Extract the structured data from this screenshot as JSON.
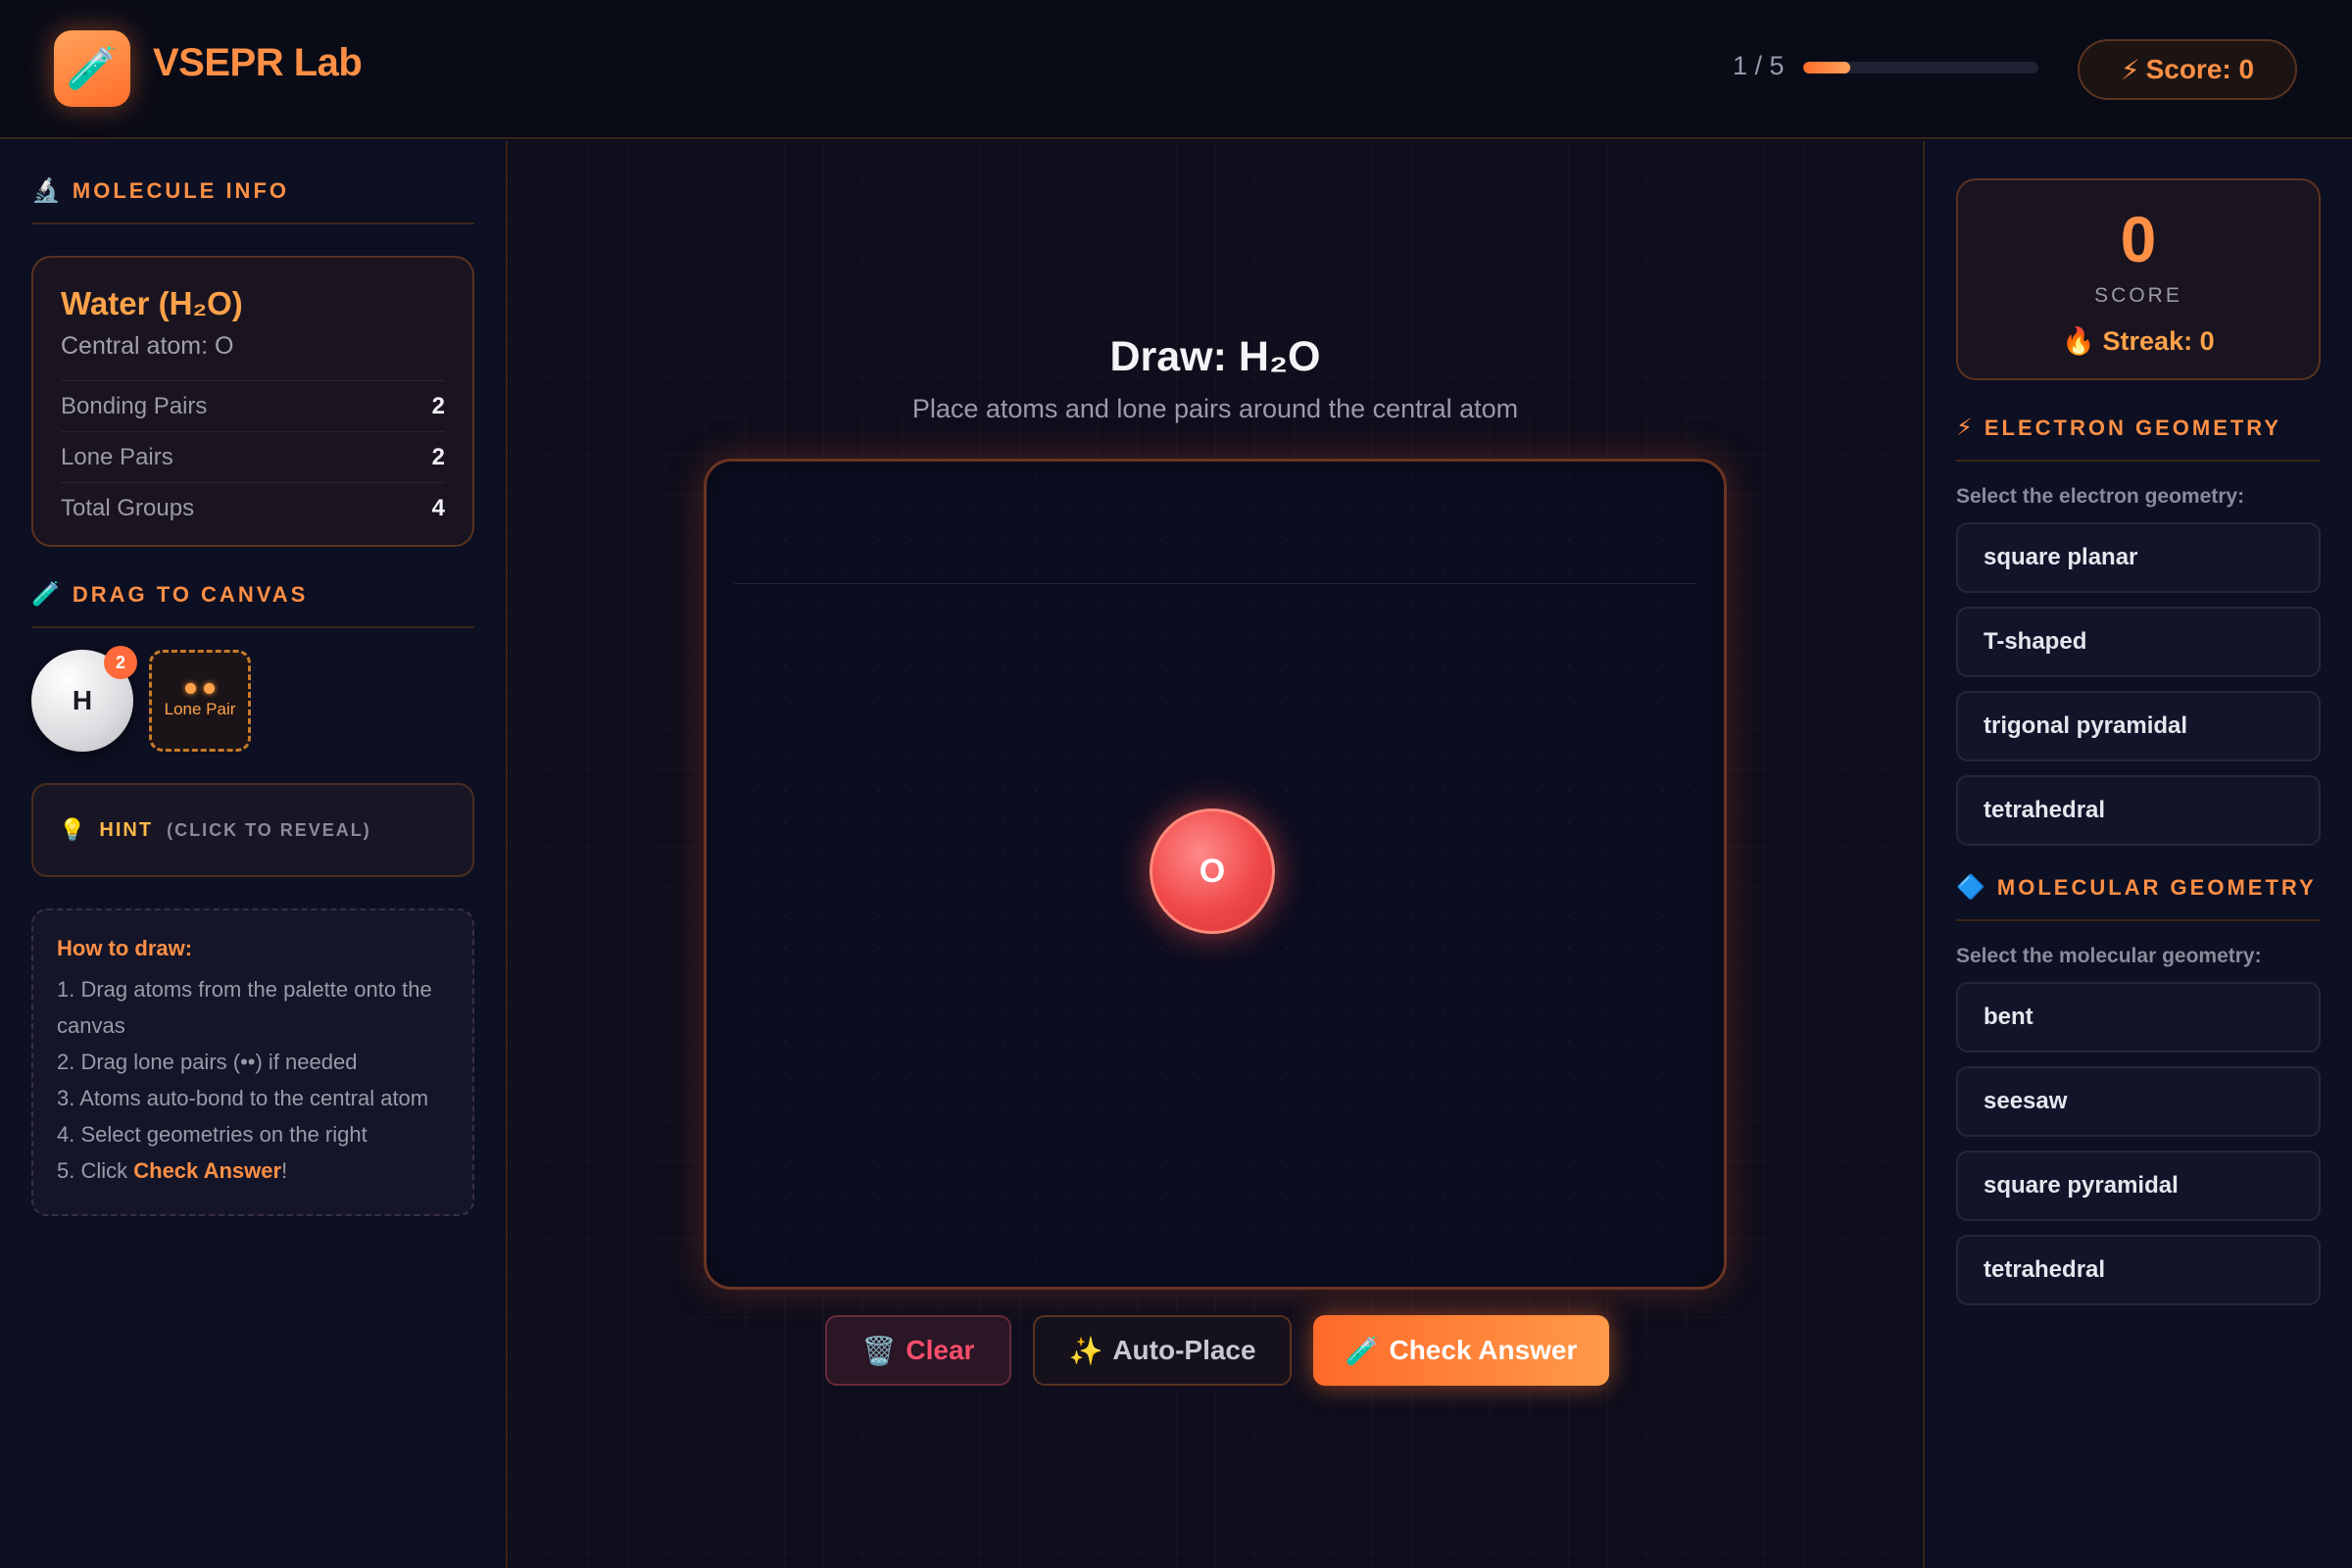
{
  "header": {
    "logo_icon": "🧪",
    "app_title": "VSEPR Lab",
    "progress_text": "1 / 5",
    "progress_fraction": 0.2,
    "score_icon": "⚡",
    "score_label": "Score: 0"
  },
  "molecule_info": {
    "heading_icon": "🔬",
    "heading": "Molecule Info",
    "name": "Water (H₂O)",
    "central": "Central atom: O",
    "rows": [
      {
        "label": "Bonding Pairs",
        "value": "2"
      },
      {
        "label": "Lone Pairs",
        "value": "2"
      },
      {
        "label": "Total Groups",
        "value": "4"
      }
    ]
  },
  "palette": {
    "heading_icon": "🧪",
    "heading": "Drag to Canvas",
    "atom_symbol": "H",
    "atom_count": "2",
    "lone_pair_label": "Lone Pair"
  },
  "hint": {
    "icon": "💡",
    "label": "HINT",
    "sub": "(CLICK TO REVEAL)"
  },
  "howto": {
    "title": "How to draw:",
    "step1": "1. Drag atoms from the palette onto the canvas",
    "step2": "2. Drag lone pairs (••) if needed",
    "step3": "3. Atoms auto-bond to the central atom",
    "step4": "4. Select geometries on the right",
    "step5_prefix": "5. Click ",
    "step5_bold": "Check Answer",
    "step5_suffix": "!"
  },
  "canvas": {
    "title": "Draw: H₂O",
    "subtitle": "Place atoms and lone pairs around the central atom",
    "central_atom": "O"
  },
  "buttons": {
    "clear_icon": "🗑️",
    "clear": "Clear",
    "auto_icon": "✨",
    "auto": "Auto-Place",
    "check_icon": "🧪",
    "check": "Check Answer"
  },
  "score_card": {
    "value": "0",
    "label": "SCORE",
    "streak_icon": "🔥",
    "streak": "Streak: 0"
  },
  "electron_geometry": {
    "heading_icon": "⚡",
    "heading": "Electron Geometry",
    "prompt": "Select the electron geometry:",
    "options": [
      "square planar",
      "T-shaped",
      "trigonal pyramidal",
      "tetrahedral"
    ]
  },
  "molecular_geometry": {
    "heading_icon": "🔷",
    "heading": "Molecular Geometry",
    "prompt": "Select the molecular geometry:",
    "options": [
      "bent",
      "seesaw",
      "square pyramidal",
      "tetrahedral"
    ]
  }
}
